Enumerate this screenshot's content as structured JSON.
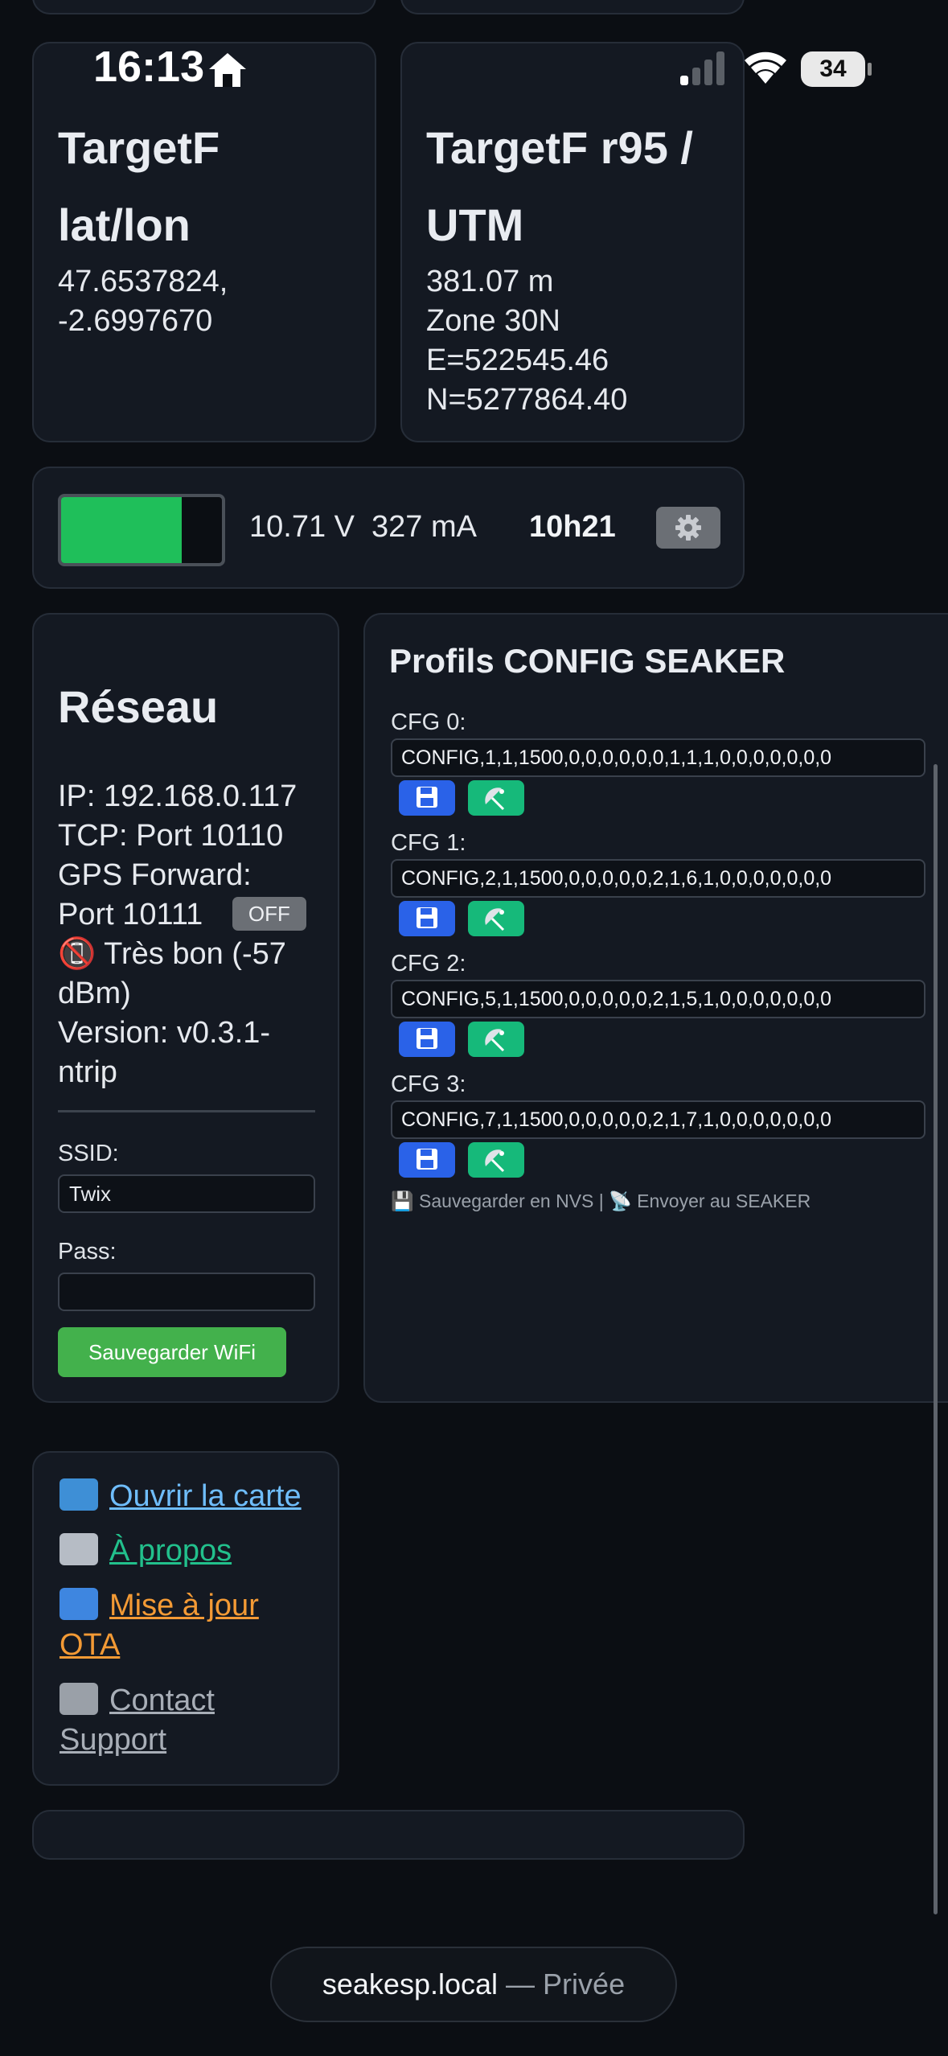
{
  "status_bar": {
    "time": "16:13",
    "battery": "34"
  },
  "target_latlon": {
    "title_line1": "TargetF",
    "title_line2": "lat/lon",
    "lat": "47.6537824,",
    "lon": "-2.6997670"
  },
  "target_r95": {
    "title_line1": "TargetF r95 /",
    "title_line2": "UTM",
    "r95": "381.07 m",
    "zone": "Zone 30N",
    "easting": "E=522545.46",
    "northing": "N=5277864.40"
  },
  "power": {
    "battery_level": 0.75,
    "voltage": "10.71 V",
    "current": "327 mA",
    "runtime": "10h21"
  },
  "network": {
    "title": "Réseau",
    "ip": "IP: 192.168.0.117",
    "tcp": "TCP: Port 10110",
    "gps_forward": "GPS Forward:",
    "gps_port": "Port 10111",
    "gps_toggle": "OFF",
    "signal_line1": "📵 Très bon (-57",
    "signal_line2": "dBm)",
    "version_line1": "Version: v0.3.1-",
    "version_line2": "ntrip",
    "ssid_label": "SSID:",
    "ssid_value": "Twix",
    "pass_label": "Pass:",
    "pass_value": "",
    "save_button": "Sauvegarder WiFi"
  },
  "profiles": {
    "title": "Profils CONFIG SEAKER",
    "items": [
      {
        "label": "CFG 0:",
        "value": "CONFIG,1,1,1500,0,0,0,0,0,0,1,1,1,0,0,0,0,0,0,0"
      },
      {
        "label": "CFG 1:",
        "value": "CONFIG,2,1,1500,0,0,0,0,0,2,1,6,1,0,0,0,0,0,0,0"
      },
      {
        "label": "CFG 2:",
        "value": "CONFIG,5,1,1500,0,0,0,0,0,2,1,5,1,0,0,0,0,0,0,0"
      },
      {
        "label": "CFG 3:",
        "value": "CONFIG,7,1,1500,0,0,0,0,0,2,1,7,1,0,0,0,0,0,0,0"
      }
    ],
    "legend": "💾 Sauvegarder en NVS | 📡 Envoyer au SEAKER"
  },
  "links": {
    "map": "Ouvrir la carte",
    "about": "À propos",
    "ota_line1": "Mise à jour",
    "ota_line2": "OTA",
    "support_line1": "Contact",
    "support_line2": "Support"
  },
  "url_bar": {
    "host": "seakesp.local",
    "separator": " — ",
    "mode": "Privée"
  },
  "colors": {
    "accent_blue": "#2a62e8",
    "accent_green": "#16b97a",
    "wifi_button": "#43b14c",
    "battery_fill": "#1fbf5a",
    "link_blue": "#6fbdfb",
    "link_green": "#22c08c",
    "link_orange": "#f39a35",
    "link_gray": "#a8aeb7"
  }
}
